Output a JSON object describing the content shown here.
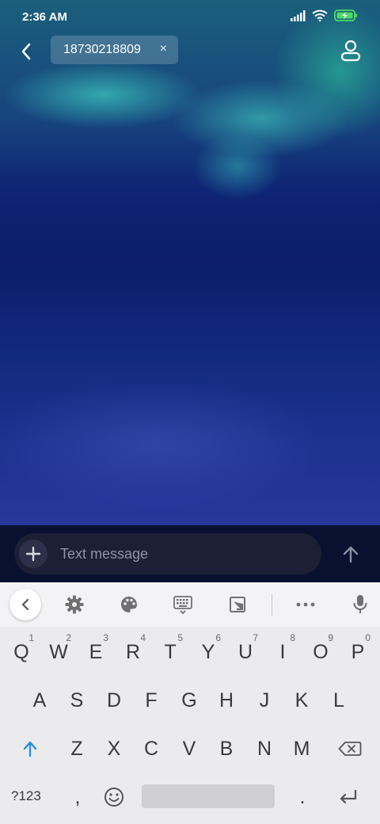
{
  "status_bar": {
    "time": "2:36 AM"
  },
  "header": {
    "recipient": "18730218809",
    "remove_symbol": "×"
  },
  "compose": {
    "placeholder": "Text message"
  },
  "keyboard": {
    "row1": [
      {
        "key": "Q",
        "hint": "1"
      },
      {
        "key": "W",
        "hint": "2"
      },
      {
        "key": "E",
        "hint": "3"
      },
      {
        "key": "R",
        "hint": "4"
      },
      {
        "key": "T",
        "hint": "5"
      },
      {
        "key": "Y",
        "hint": "6"
      },
      {
        "key": "U",
        "hint": "7"
      },
      {
        "key": "I",
        "hint": "8"
      },
      {
        "key": "O",
        "hint": "9"
      },
      {
        "key": "P",
        "hint": "0"
      }
    ],
    "row2": [
      "A",
      "S",
      "D",
      "F",
      "G",
      "H",
      "J",
      "K",
      "L"
    ],
    "row3": [
      "Z",
      "X",
      "C",
      "V",
      "B",
      "N",
      "M"
    ],
    "symbols_label": "?123",
    "comma": ",",
    "period": "."
  },
  "icons": {
    "back": "back-arrow-icon",
    "contact": "person-icon",
    "attach": "plus-icon",
    "send": "arrow-up-icon",
    "settings": "gear-icon",
    "theme": "palette-icon",
    "keyboard": "keyboard-icon",
    "resize": "resize-icon",
    "more": "more-icon",
    "voice": "microphone-icon",
    "shift": "shift-arrow-icon",
    "backspace": "backspace-icon",
    "emoji": "emoji-icon",
    "enter": "enter-icon"
  },
  "colors": {
    "accent": "#1a8fe3",
    "battery": "#4cd964",
    "keyboard_bg": "#ebebed"
  }
}
